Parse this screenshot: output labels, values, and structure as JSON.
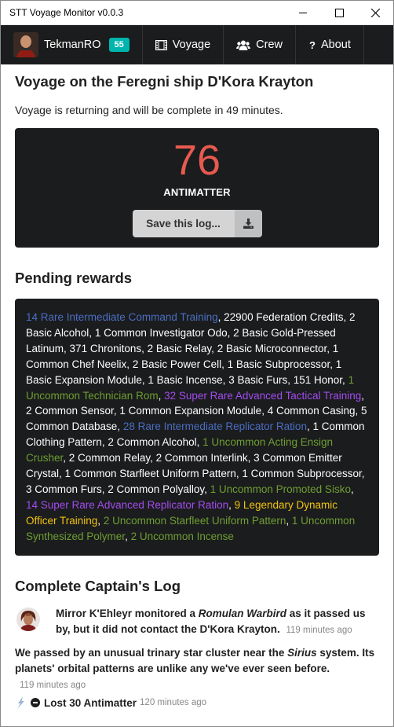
{
  "window": {
    "title": "STT Voyage Monitor v0.0.3"
  },
  "menu": {
    "user_name": "TekmanRO",
    "user_level": "55",
    "voyage_label": "Voyage",
    "crew_label": "Crew",
    "about_label": "About",
    "about_icon_glyph": "?"
  },
  "voyage": {
    "title": "Voyage on the Feregni ship D'Kora Krayton",
    "status": "Voyage is returning and will be complete in 49 minutes.",
    "antimatter_value": "76",
    "antimatter_label": "ANTIMATTER",
    "save_label": "Save this log..."
  },
  "rewards": {
    "heading": "Pending rewards",
    "items": [
      {
        "text": "14 Rare Intermediate Command Training",
        "rarity": "rare"
      },
      {
        "text": "22900 Federation Credits",
        "rarity": "basic"
      },
      {
        "text": "2 Basic Alcohol",
        "rarity": "basic"
      },
      {
        "text": "1 Common Investigator Odo",
        "rarity": "basic"
      },
      {
        "text": "2 Basic Gold-Pressed Latinum",
        "rarity": "basic"
      },
      {
        "text": "371 Chronitons",
        "rarity": "basic"
      },
      {
        "text": "2 Basic Relay",
        "rarity": "basic"
      },
      {
        "text": "2 Basic Microconnector",
        "rarity": "basic"
      },
      {
        "text": "1 Common Chef Neelix",
        "rarity": "basic"
      },
      {
        "text": "2 Basic Power Cell",
        "rarity": "basic"
      },
      {
        "text": "1 Basic Subprocessor",
        "rarity": "basic"
      },
      {
        "text": "1 Basic Expansion Module",
        "rarity": "basic"
      },
      {
        "text": "1 Basic Incense",
        "rarity": "basic"
      },
      {
        "text": "3 Basic Furs",
        "rarity": "basic"
      },
      {
        "text": "151 Honor",
        "rarity": "basic"
      },
      {
        "text": "1 Uncommon Technician Rom",
        "rarity": "uncommon"
      },
      {
        "text": "32 Super Rare Advanced Tactical Training",
        "rarity": "srare"
      },
      {
        "text": "2 Common Sensor",
        "rarity": "basic"
      },
      {
        "text": "1 Common Expansion Module",
        "rarity": "basic"
      },
      {
        "text": "4 Common Casing",
        "rarity": "basic"
      },
      {
        "text": "5 Common Database",
        "rarity": "basic"
      },
      {
        "text": "28 Rare Intermediate Replicator Ration",
        "rarity": "rare"
      },
      {
        "text": "1 Common Clothing Pattern",
        "rarity": "basic"
      },
      {
        "text": "2 Common Alcohol",
        "rarity": "basic"
      },
      {
        "text": "1 Uncommon Acting Ensign Crusher",
        "rarity": "uncommon"
      },
      {
        "text": "2 Common Relay",
        "rarity": "basic"
      },
      {
        "text": "2 Common Interlink",
        "rarity": "basic"
      },
      {
        "text": "3 Common Emitter Crystal",
        "rarity": "basic"
      },
      {
        "text": "1 Common Starfleet Uniform Pattern",
        "rarity": "basic"
      },
      {
        "text": "1 Common Subprocessor",
        "rarity": "basic"
      },
      {
        "text": "3 Common Furs",
        "rarity": "basic"
      },
      {
        "text": "2 Common Polyalloy",
        "rarity": "basic"
      },
      {
        "text": "1 Uncommon Promoted Sisko",
        "rarity": "uncommon"
      },
      {
        "text": "14 Super Rare Advanced Replicator Ration",
        "rarity": "srare"
      },
      {
        "text": "9 Legendary Dynamic Officer Training",
        "rarity": "legend"
      },
      {
        "text": "2 Uncommon Starfleet Uniform Pattern",
        "rarity": "uncommon"
      },
      {
        "text": "1 Uncommon Synthesized Polymer",
        "rarity": "uncommon"
      },
      {
        "text": "2 Uncommon Incense",
        "rarity": "uncommon"
      }
    ]
  },
  "log": {
    "heading": "Complete Captain's Log",
    "entry1": {
      "pre": "Mirror K'Ehleyr monitored a ",
      "em": "Romulan Warbird",
      "post": " as it passed us by, but it did not contact the D'Kora Krayton.",
      "time": "119 minutes ago"
    },
    "entry2": {
      "pre": "We passed by an unusual trinary star cluster near the ",
      "em": "Sirius",
      "post": " system. Its planets' orbital patterns are unlike any we've ever seen before.",
      "time": "119 minutes ago"
    },
    "entry3": {
      "text": "Lost 30 Antimatter",
      "time": "120 minutes ago"
    }
  },
  "colors": {
    "rare": "#4a6ec4",
    "uncommon": "#6e9e34",
    "super_rare": "#a24cf0",
    "legendary": "#f1c40f",
    "antimatter": "#e85a4f",
    "level_badge": "#00b5ad"
  }
}
